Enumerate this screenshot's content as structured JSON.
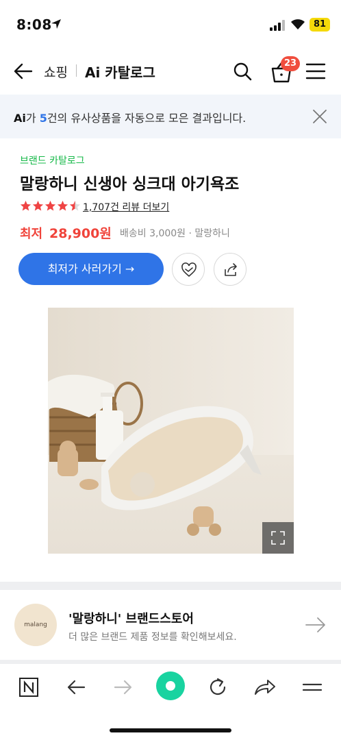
{
  "status_bar": {
    "time": "8:08",
    "battery": "81"
  },
  "header": {
    "shop_label": "쇼핑",
    "catalog_label": "Ai 카탈로그",
    "cart_count": "23"
  },
  "banner": {
    "ai": "Ai",
    "prefix": "가 ",
    "count": "5",
    "suffix": "건의 유사상품을 자동으로 모은 결과입니다."
  },
  "product": {
    "brand_catalog": "브랜드 카탈로그",
    "title": "말랑하니 신생아 싱크대 아기욕조",
    "rating": 4.5,
    "review_text": "1,707건 리뷰 더보기",
    "price_label": "최저",
    "price": "28,900원",
    "shipping": "배송비 3,000원 · 말랑하니",
    "buy_label": "최저가 사러가기 →"
  },
  "store": {
    "logo_text": "malang honey",
    "title": "'말랑하니' 브랜드스토어",
    "subtitle": "더 많은 브랜드 제품 정보를 확인해보세요."
  },
  "colors": {
    "accent_blue": "#2f74e7",
    "price_red": "#f0433a",
    "brand_green": "#14b847",
    "naver_green": "#19d3a0"
  }
}
